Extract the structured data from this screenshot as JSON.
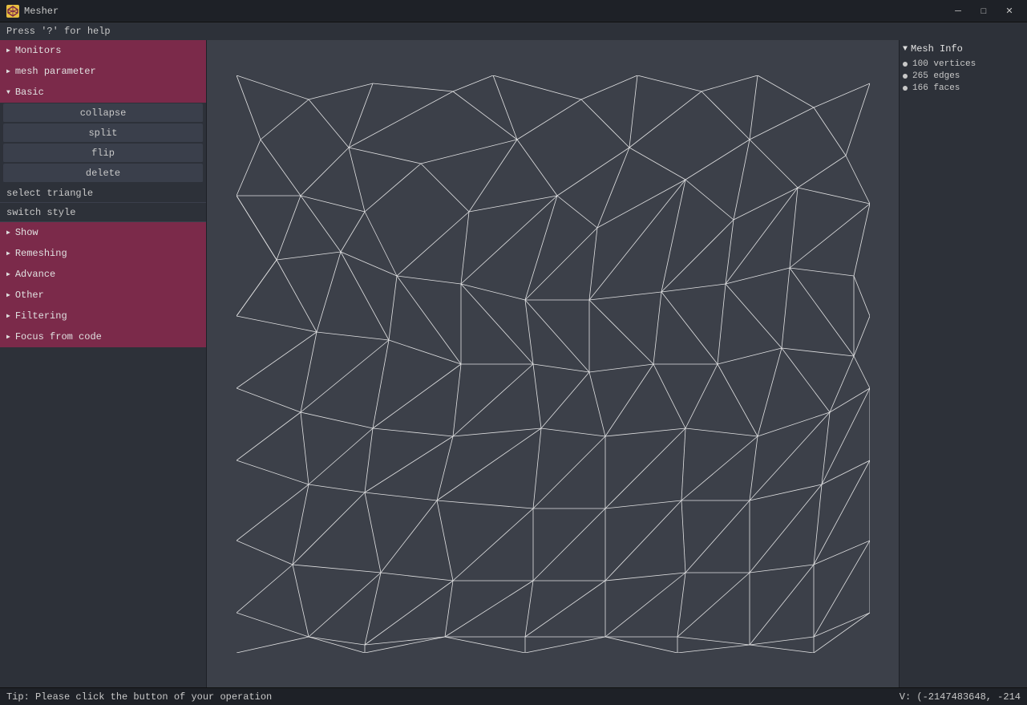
{
  "titlebar": {
    "app_name": "Mesher",
    "minimize_label": "─",
    "maximize_label": "□",
    "close_label": "✕"
  },
  "info_bar": {
    "text": "Press '?' for help"
  },
  "sidebar": {
    "monitors": {
      "label": "Monitors",
      "expanded": false
    },
    "mesh_parameter": {
      "label": "mesh parameter",
      "expanded": false
    },
    "basic": {
      "label": "Basic",
      "expanded": true,
      "buttons": [
        "collapse",
        "split",
        "flip",
        "delete"
      ],
      "special_items": [
        "select triangle",
        "switch style"
      ]
    },
    "show": {
      "label": "Show",
      "expanded": false
    },
    "remeshing": {
      "label": "Remeshing",
      "expanded": false
    },
    "advance": {
      "label": "Advance",
      "expanded": false
    },
    "other": {
      "label": "Other",
      "expanded": false
    },
    "filtering": {
      "label": "Filtering",
      "expanded": false
    },
    "focus_from_code": {
      "label": "Focus from code",
      "expanded": false
    }
  },
  "mesh_info": {
    "title": "Mesh Info",
    "vertices": "100 vertices",
    "edges": "265 edges",
    "faces": "166 faces"
  },
  "status_bar": {
    "tip": "Tip: Please click the button of your operation",
    "coordinates": "V: (-2147483648, -214"
  }
}
